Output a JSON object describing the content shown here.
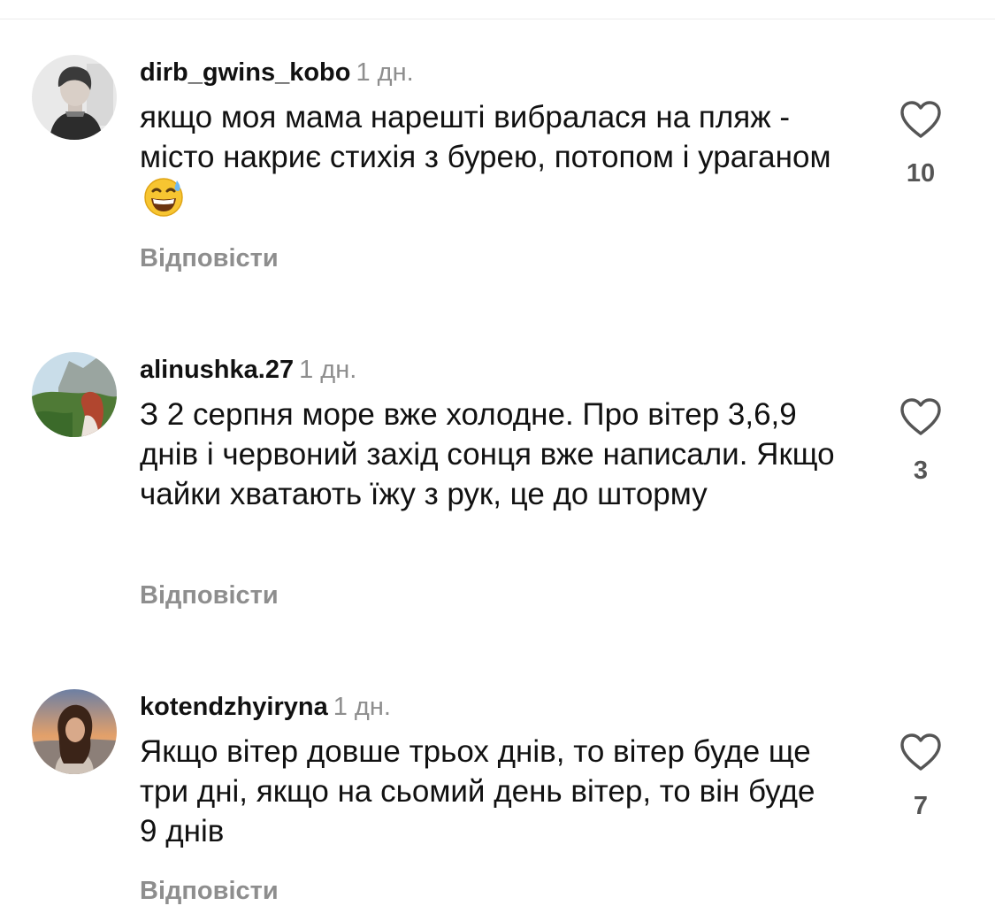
{
  "comments": [
    {
      "username": "dirb_gwins_kobo",
      "time": "1 дн.",
      "text": "якщо моя мама нарешті вибралася на пляж - місто накриє стихія з бурею, потопом і ураганом",
      "emoji": "grinning-sweat-emoji",
      "likes": "10",
      "reply_label": "Відповісти"
    },
    {
      "username": "alinushka.27",
      "time": "1 дн.",
      "text": "З 2 серпня море вже холодне. Про вітер 3,6,9 днів і червоний захід сонця вже написали. Якщо чайки хватають їжу з рук, це до шторму",
      "likes": "3",
      "reply_label": "Відповісти"
    },
    {
      "username": "kotendzhyiryna",
      "time": "1 дн.",
      "text": "Якщо вітер довше трьох днів, то вітер буде ще три дні, якщо на сьомий день вітер, то він буде 9 днів",
      "likes": "7",
      "reply_label": "Відповісти"
    }
  ],
  "icons": {
    "like": "heart-outline-icon"
  },
  "colors": {
    "text": "#111111",
    "muted": "#8e8e8e",
    "like_count": "#555555",
    "divider": "#ececec"
  }
}
